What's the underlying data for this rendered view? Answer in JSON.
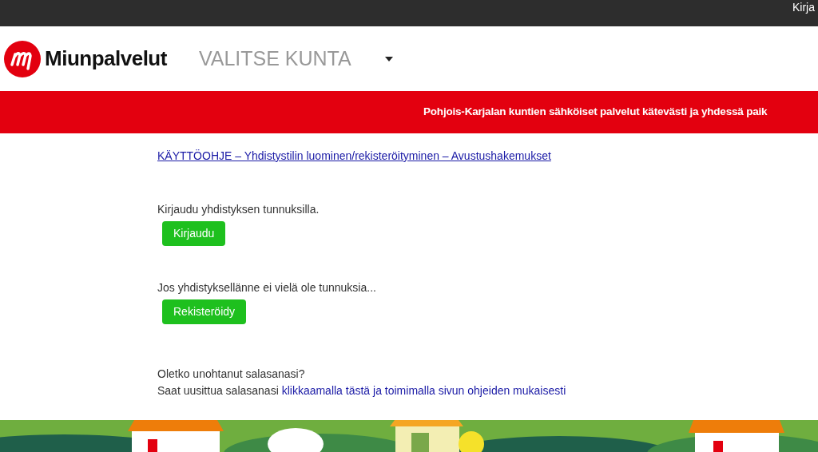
{
  "top_bar": {
    "login_link": "Kirja"
  },
  "header": {
    "logo_text": "Miunpalvelut",
    "municipality_select": "VALITSE KUNTA"
  },
  "banner": {
    "text": "Pohjois-Karjalan kuntien sähköiset palvelut kätevästi ja yhdessä paik"
  },
  "content": {
    "guide_link": "KÄYTTÖOHJE – Yhdistystilin luominen/rekisteröityminen – Avustushakemukset",
    "sections": [
      {
        "text": "Kirjaudu yhdistyksen tunnuksilla.",
        "button": "Kirjaudu"
      },
      {
        "text": "Jos yhdistyksellänne ei vielä ole tunnuksia...",
        "button": "Rekisteröidy"
      }
    ],
    "password_question": "Oletko unohtanut salasanasi?",
    "password_text": "Saat uusittua salasanasi ",
    "password_link": "klikkaamalla tästä ja toimimalla sivun ohjeiden mukaisesti"
  }
}
